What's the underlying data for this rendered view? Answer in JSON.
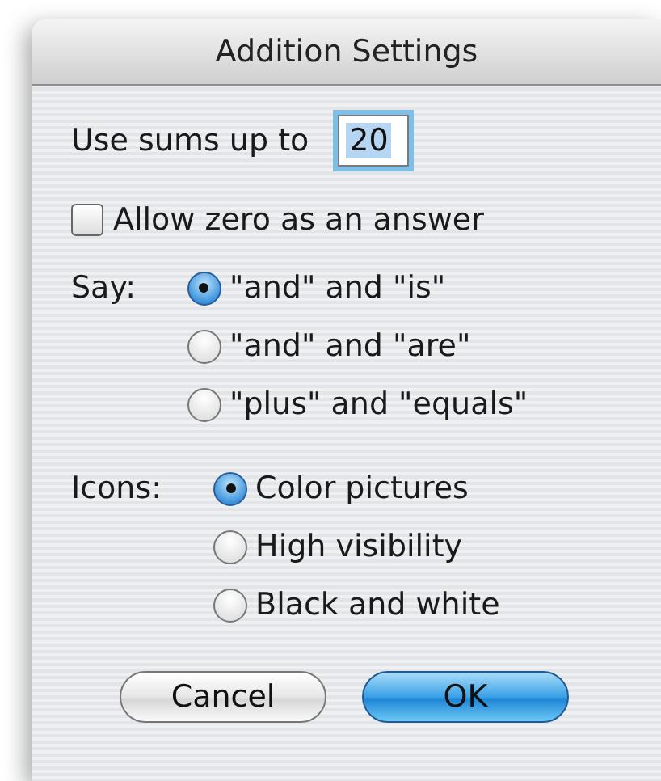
{
  "window": {
    "title": "Addition Settings"
  },
  "sums": {
    "label": "Use sums up to",
    "value": "20",
    "focused": true
  },
  "allow_zero": {
    "label": "Allow zero as an answer",
    "checked": false
  },
  "groups": [
    {
      "label": "Say:",
      "options": [
        {
          "label": "\"and\" and \"is\"",
          "selected": true
        },
        {
          "label": "\"and\" and \"are\"",
          "selected": false
        },
        {
          "label": "\"plus\" and \"equals\"",
          "selected": false
        }
      ]
    },
    {
      "label": "Icons:",
      "options": [
        {
          "label": "Color pictures",
          "selected": true
        },
        {
          "label": "High visibility",
          "selected": false
        },
        {
          "label": "Black and white",
          "selected": false
        }
      ]
    }
  ],
  "buttons": [
    {
      "label": "Cancel",
      "default": false
    },
    {
      "label": "OK",
      "default": true
    }
  ]
}
